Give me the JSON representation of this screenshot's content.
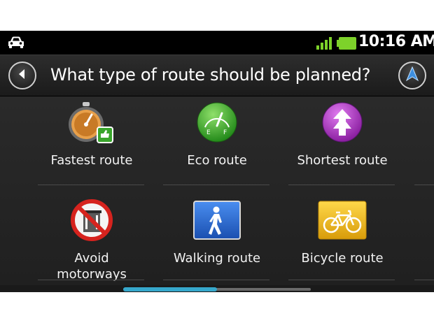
{
  "status_bar": {
    "time": "10:16 AM",
    "icons": [
      "car-icon",
      "signal-icon",
      "battery-icon"
    ]
  },
  "header": {
    "title": "What type of route should be planned?",
    "back_icon": "back-arrow-icon",
    "nav_icon": "navigation-arrow-icon"
  },
  "route_options": [
    {
      "label": "Fastest route",
      "icon": "stopwatch-icon"
    },
    {
      "label": "Eco route",
      "icon": "eco-gauge-icon"
    },
    {
      "label": "Shortest route",
      "icon": "shortest-arrow-icon"
    },
    {
      "label": "Avoid motorways",
      "icon": "no-motorway-icon"
    },
    {
      "label": "Walking route",
      "icon": "pedestrian-icon"
    },
    {
      "label": "Bicycle route",
      "icon": "bicycle-icon"
    }
  ],
  "colors": {
    "accent": "#36a8cc",
    "eco_green": "#3aa52c",
    "shortest_purple": "#a033b8",
    "walking_blue": "#1f5fc4",
    "bicycle_yellow": "#e8b514",
    "avoid_red": "#d6231e"
  },
  "scroll_progress": 0.5
}
